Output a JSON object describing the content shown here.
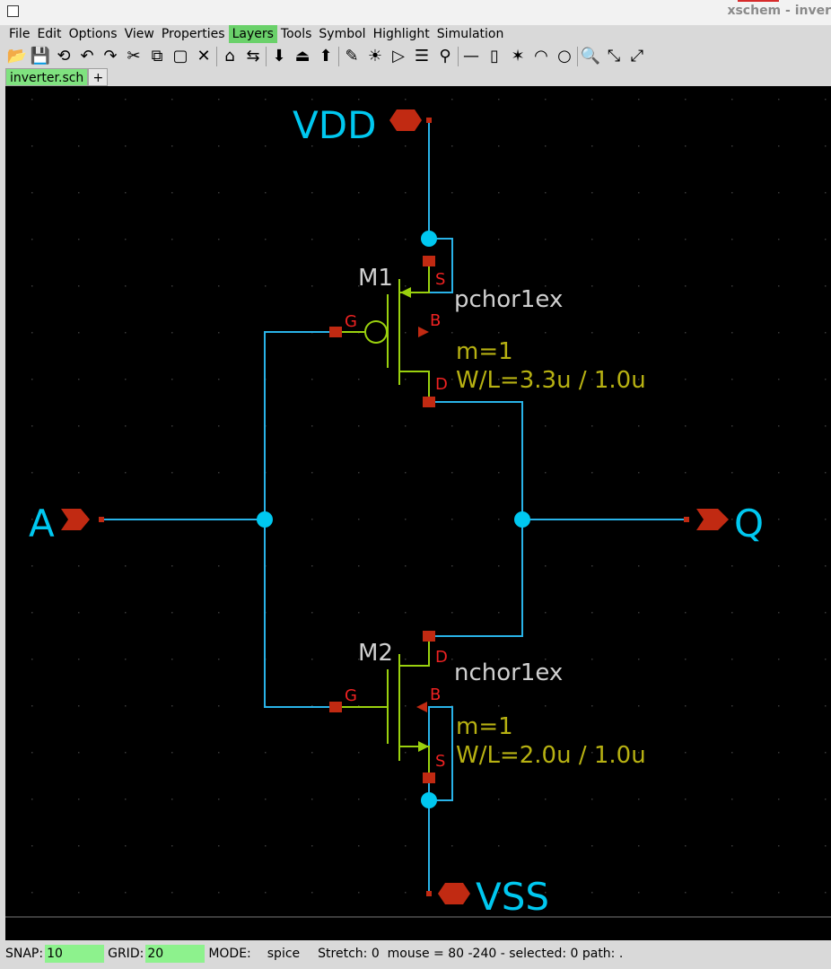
{
  "window": {
    "title": "xschem - inver"
  },
  "menubar": {
    "items": [
      "File",
      "Edit",
      "Options",
      "View",
      "Properties",
      "Layers",
      "Tools",
      "Symbol",
      "Highlight",
      "Simulation"
    ],
    "active": "Layers"
  },
  "toolbar": {
    "icons": [
      "open-icon",
      "save-icon",
      "reload-icon",
      "undo-icon",
      "redo-icon",
      "cut-icon",
      "copy-icon",
      "paste-icon",
      "delete-icon",
      "place-symbol-icon",
      "swap-icon",
      "push-icon",
      "make-symbol-icon",
      "pop-icon",
      "draw-icon",
      "bright-icon",
      "gate-icon",
      "list-icon",
      "pin-icon",
      "line-icon",
      "rect-icon",
      "polygon-icon",
      "arc-icon",
      "circle-icon",
      "zoom-icon",
      "zoom-in-icon",
      "zoom-fit-icon"
    ],
    "glyphs": [
      "📂",
      "💾",
      "⟲",
      "↶",
      "↷",
      "✂",
      "⧉",
      "▢",
      "✕",
      "⌂",
      "⇆",
      "⬇",
      "⏏",
      "⬆",
      "✎",
      "☀",
      "▷",
      "☰",
      "⚲",
      "—",
      "▯",
      "✶",
      "◠",
      "○",
      "🔍",
      "⤡",
      "⤢"
    ]
  },
  "tabs": {
    "active": "inverter.sch",
    "add": "+"
  },
  "schematic": {
    "pins": [
      {
        "id": "vdd-pin",
        "name": "VDD"
      },
      {
        "id": "vss-pin",
        "name": "VSS"
      },
      {
        "id": "a-pin",
        "name": "A"
      },
      {
        "id": "q-pin",
        "name": "Q"
      }
    ],
    "transistors": [
      {
        "id": "m1",
        "name": "M1",
        "model": "pchor1ex",
        "mult": "m=1",
        "size": "W/L=3.3u / 1.0u",
        "terminals": {
          "gate": "G",
          "source": "S",
          "drain": "D",
          "bulk": "B"
        }
      },
      {
        "id": "m2",
        "name": "M2",
        "model": "nchor1ex",
        "mult": "m=1",
        "size": "W/L=2.0u / 1.0u",
        "terminals": {
          "gate": "G",
          "source": "S",
          "drain": "D",
          "bulk": "B"
        }
      }
    ],
    "colors": {
      "wire": "#29b3e8",
      "node": "#00c8f0",
      "pin": "#c12a12",
      "device": "#9ad10e",
      "pin_label": "#ee2222",
      "net_label": "#00c8f0",
      "ref_label": "#d0d0d0",
      "param_label": "#b7b112",
      "grid": "#3a3a3a"
    }
  },
  "status": {
    "snap_label": "SNAP:",
    "snap": "10",
    "grid_label": "GRID:",
    "grid": "20",
    "mode_label": "MODE:",
    "mode": "spice",
    "info": "Stretch: 0  mouse = 80 -240 - selected: 0 path: ."
  }
}
